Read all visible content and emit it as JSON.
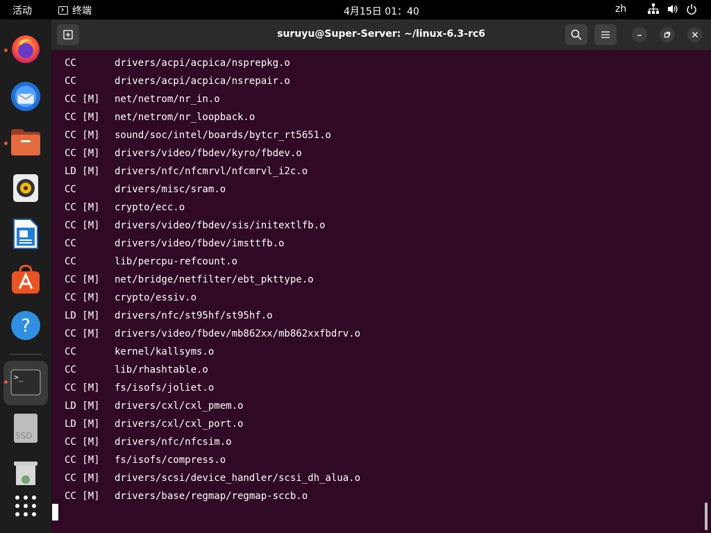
{
  "topbar": {
    "activities": "活动",
    "app_name": "终端",
    "clock": "4月15日  01：40",
    "lang": "zh",
    "icons": [
      "network-icon",
      "volume-icon",
      "power-icon"
    ]
  },
  "dock": {
    "items": [
      "firefox",
      "thunderbird",
      "files",
      "rhythmbox",
      "libreoffice-writer",
      "app-center",
      "help",
      "terminal",
      "ssd-drive",
      "trash",
      "show-apps"
    ],
    "ssd_label": "SSD"
  },
  "window": {
    "title": "suruyu@Super-Server: ~/linux-6.3-rc6"
  },
  "terminal": {
    "lines": [
      {
        "tag": "CC",
        "path": "drivers/acpi/acpica/nsprepkg.o"
      },
      {
        "tag": "CC",
        "path": "drivers/acpi/acpica/nsrepair.o"
      },
      {
        "tag": "CC [M]",
        "path": "net/netrom/nr_in.o"
      },
      {
        "tag": "CC [M]",
        "path": "net/netrom/nr_loopback.o"
      },
      {
        "tag": "CC [M]",
        "path": "sound/soc/intel/boards/bytcr_rt5651.o"
      },
      {
        "tag": "CC [M]",
        "path": "drivers/video/fbdev/kyro/fbdev.o"
      },
      {
        "tag": "LD [M]",
        "path": "drivers/nfc/nfcmrvl/nfcmrvl_i2c.o"
      },
      {
        "tag": "CC",
        "path": "drivers/misc/sram.o"
      },
      {
        "tag": "CC [M]",
        "path": "crypto/ecc.o"
      },
      {
        "tag": "CC [M]",
        "path": "drivers/video/fbdev/sis/initextlfb.o"
      },
      {
        "tag": "CC",
        "path": "drivers/video/fbdev/imsttfb.o"
      },
      {
        "tag": "CC",
        "path": "lib/percpu-refcount.o"
      },
      {
        "tag": "CC [M]",
        "path": "net/bridge/netfilter/ebt_pkttype.o"
      },
      {
        "tag": "CC [M]",
        "path": "crypto/essiv.o"
      },
      {
        "tag": "LD [M]",
        "path": "drivers/nfc/st95hf/st95hf.o"
      },
      {
        "tag": "CC [M]",
        "path": "drivers/video/fbdev/mb862xx/mb862xxfbdrv.o"
      },
      {
        "tag": "CC",
        "path": "kernel/kallsyms.o"
      },
      {
        "tag": "CC",
        "path": "lib/rhashtable.o"
      },
      {
        "tag": "CC [M]",
        "path": "fs/isofs/joliet.o"
      },
      {
        "tag": "LD [M]",
        "path": "drivers/cxl/cxl_pmem.o"
      },
      {
        "tag": "LD [M]",
        "path": "drivers/cxl/cxl_port.o"
      },
      {
        "tag": "CC [M]",
        "path": "drivers/nfc/nfcsim.o"
      },
      {
        "tag": "CC [M]",
        "path": "fs/isofs/compress.o"
      },
      {
        "tag": "CC [M]",
        "path": "drivers/scsi/device_handler/scsi_dh_alua.o"
      },
      {
        "tag": "CC [M]",
        "path": "drivers/base/regmap/regmap-sccb.o"
      }
    ]
  }
}
